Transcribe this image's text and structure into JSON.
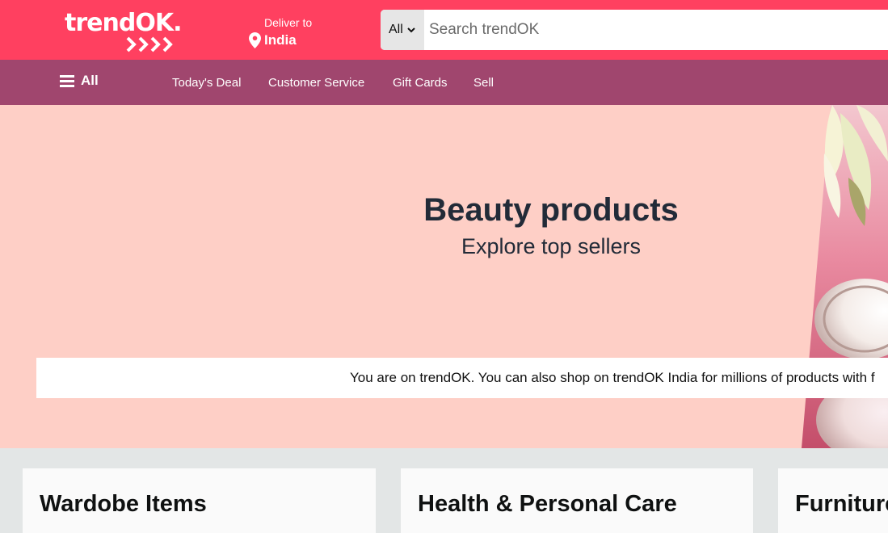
{
  "header": {
    "logo_text": "trendOK.",
    "deliver_label": "Deliver to",
    "deliver_location": "India",
    "search_category": "All",
    "search_placeholder": "Search trendOK"
  },
  "nav": {
    "all_label": "All",
    "links": [
      "Today's Deal",
      "Customer Service",
      "Gift Cards",
      "Sell"
    ]
  },
  "hero": {
    "title": "Beauty products",
    "subtitle": "Explore top sellers",
    "notice": "You are on trendOK. You can also shop on trendOK India for millions of products with f"
  },
  "cards": [
    "Wardobe Items",
    "Health & Personal Care",
    "Furniture"
  ],
  "colors": {
    "header_bg": "#ff4060",
    "nav_bg": "#a0466e",
    "hero_bg": "#fecfc6",
    "page_bg": "#e3e6e6"
  },
  "icons": [
    "chevrons-icon",
    "location-pin-icon",
    "chevron-down-icon",
    "hamburger-menu-icon"
  ]
}
